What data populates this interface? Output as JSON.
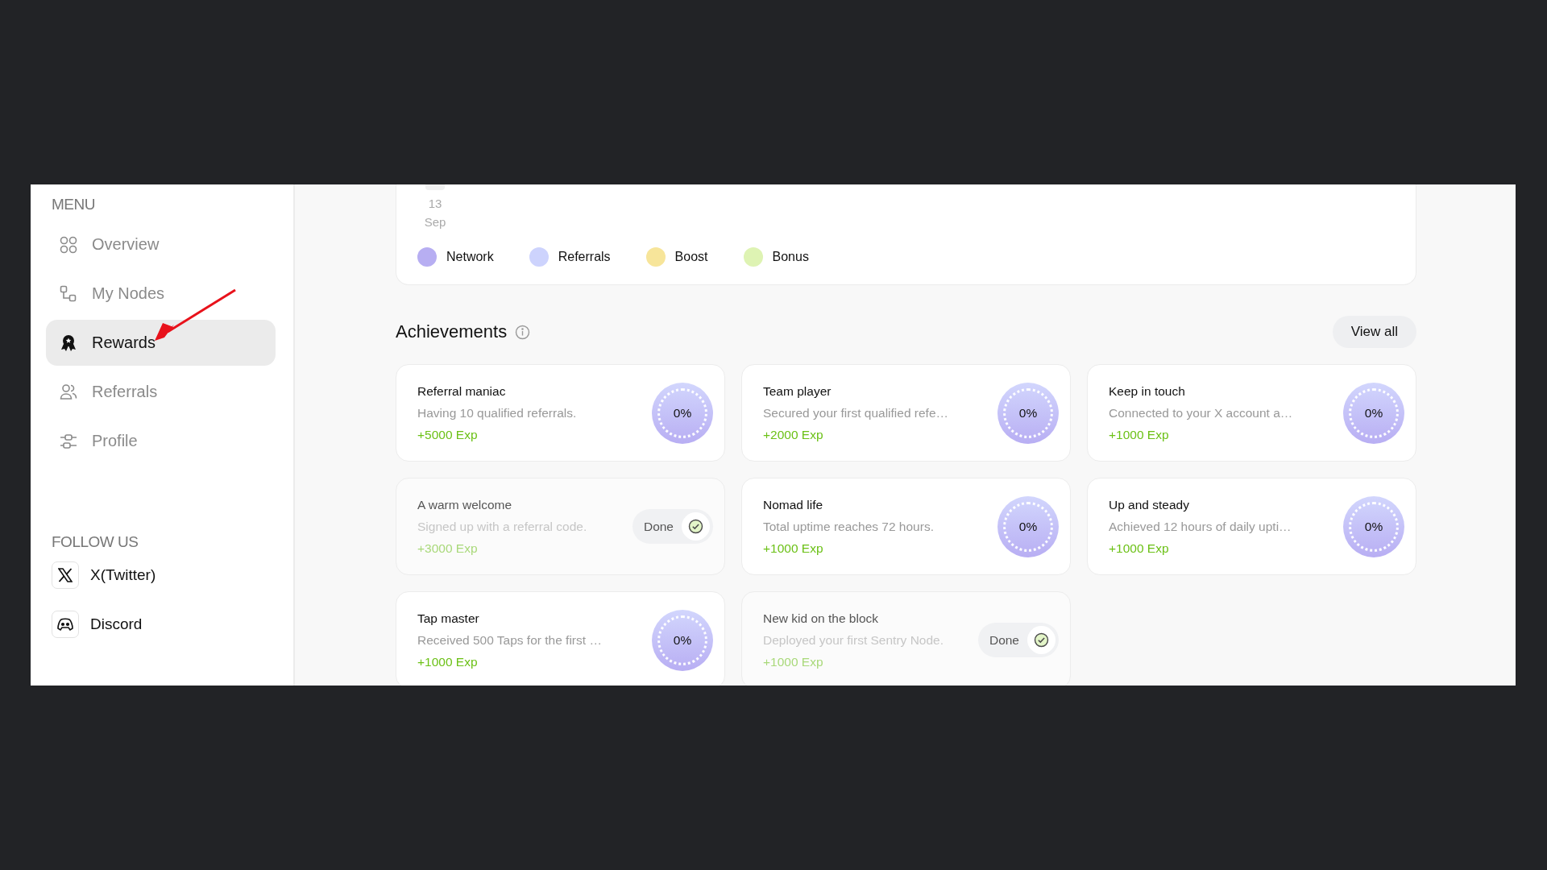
{
  "sidebar": {
    "menu_heading": "MENU",
    "items": [
      {
        "label": "Overview",
        "selected": false
      },
      {
        "label": "My Nodes",
        "selected": false
      },
      {
        "label": "Rewards",
        "selected": true
      },
      {
        "label": "Referrals",
        "selected": false
      },
      {
        "label": "Profile",
        "selected": false
      }
    ],
    "follow_heading": "FOLLOW US",
    "socials": [
      {
        "label": "X(Twitter)"
      },
      {
        "label": "Discord"
      }
    ]
  },
  "chart": {
    "date_day": "13",
    "date_month": "Sep",
    "legend": [
      {
        "label": "Network",
        "color": "#b7aef2"
      },
      {
        "label": "Referrals",
        "color": "#cdd3fd"
      },
      {
        "label": "Boost",
        "color": "#f7e59a"
      },
      {
        "label": "Bonus",
        "color": "#def3b3"
      }
    ]
  },
  "achievements": {
    "title": "Achievements",
    "view_all": "View all",
    "cards": [
      {
        "kind": "progress",
        "title": "Referral maniac",
        "description": "Having 10 qualified referrals.",
        "reward": "+5000 Exp",
        "percent": "0%"
      },
      {
        "kind": "progress",
        "title": "Team player",
        "description": "Secured your first qualified refe…",
        "reward": "+2000 Exp",
        "percent": "0%"
      },
      {
        "kind": "progress",
        "title": "Keep in touch",
        "description": "Connected to your X account a…",
        "reward": "+1000 Exp",
        "percent": "0%"
      },
      {
        "kind": "done",
        "title": "A warm welcome",
        "description": "Signed up with a referral code.",
        "reward": "+3000 Exp",
        "status": "Done"
      },
      {
        "kind": "progress",
        "title": "Nomad life",
        "description": "Total uptime reaches 72 hours.",
        "reward": "+1000 Exp",
        "percent": "0%"
      },
      {
        "kind": "progress",
        "title": "Up and steady",
        "description": "Achieved 12 hours of daily upti…",
        "reward": "+1000 Exp",
        "percent": "0%"
      },
      {
        "kind": "progress",
        "title": "Tap master",
        "description": "Received 500 Taps for the first …",
        "reward": "+1000 Exp",
        "percent": "0%"
      },
      {
        "kind": "done",
        "title": "New kid on the block",
        "description": "Deployed your first Sentry Node.",
        "reward": "+1000 Exp",
        "status": "Done"
      }
    ]
  }
}
